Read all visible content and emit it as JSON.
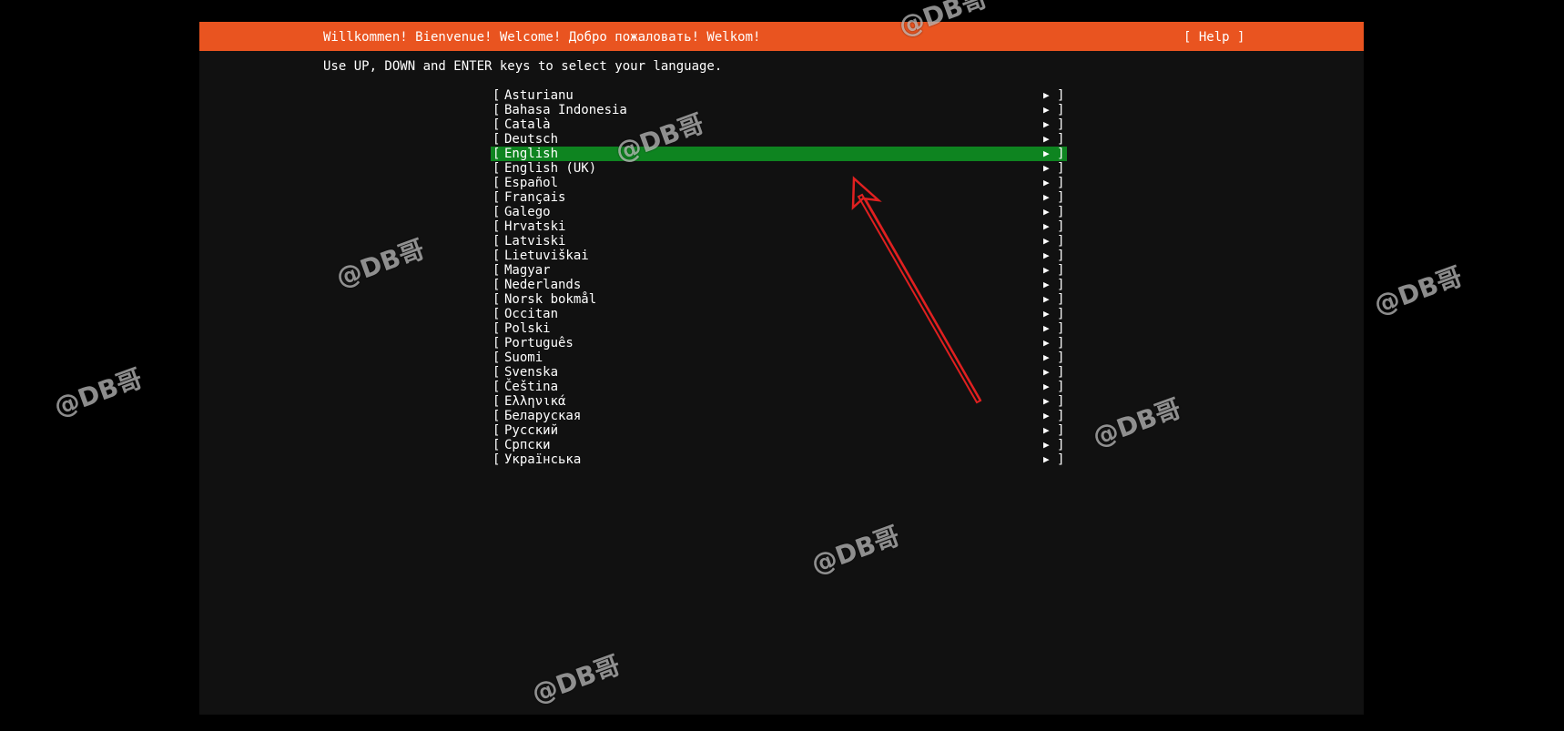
{
  "header": {
    "title": "Willkommen! Bienvenue! Welcome! Добро пожаловать! Welkom!",
    "help_label": "[ Help ]",
    "bg_color": "#E95420"
  },
  "instruction": "Use UP, DOWN and ENTER keys to select your language.",
  "selection_color": "#0E8420",
  "languages": [
    {
      "name": "Asturianu"
    },
    {
      "name": "Bahasa Indonesia"
    },
    {
      "name": "Català"
    },
    {
      "name": "Deutsch"
    },
    {
      "name": "English",
      "selected": true
    },
    {
      "name": "English (UK)"
    },
    {
      "name": "Español"
    },
    {
      "name": "Français"
    },
    {
      "name": "Galego"
    },
    {
      "name": "Hrvatski"
    },
    {
      "name": "Latviski"
    },
    {
      "name": "Lietuviškai"
    },
    {
      "name": "Magyar"
    },
    {
      "name": "Nederlands"
    },
    {
      "name": "Norsk bokmål"
    },
    {
      "name": "Occitan"
    },
    {
      "name": "Polski"
    },
    {
      "name": "Português"
    },
    {
      "name": "Suomi"
    },
    {
      "name": "Svenska"
    },
    {
      "name": "Čeština"
    },
    {
      "name": "Ελληνικά"
    },
    {
      "name": "Беларуская"
    },
    {
      "name": "Русский"
    },
    {
      "name": "Српски"
    },
    {
      "name": "Українська"
    }
  ],
  "list_glyphs": {
    "left_bracket": "[",
    "right_bracket": "]",
    "arrow": "▶"
  },
  "watermark_text": "@DB哥",
  "annotation": {
    "color": "#E02020"
  }
}
